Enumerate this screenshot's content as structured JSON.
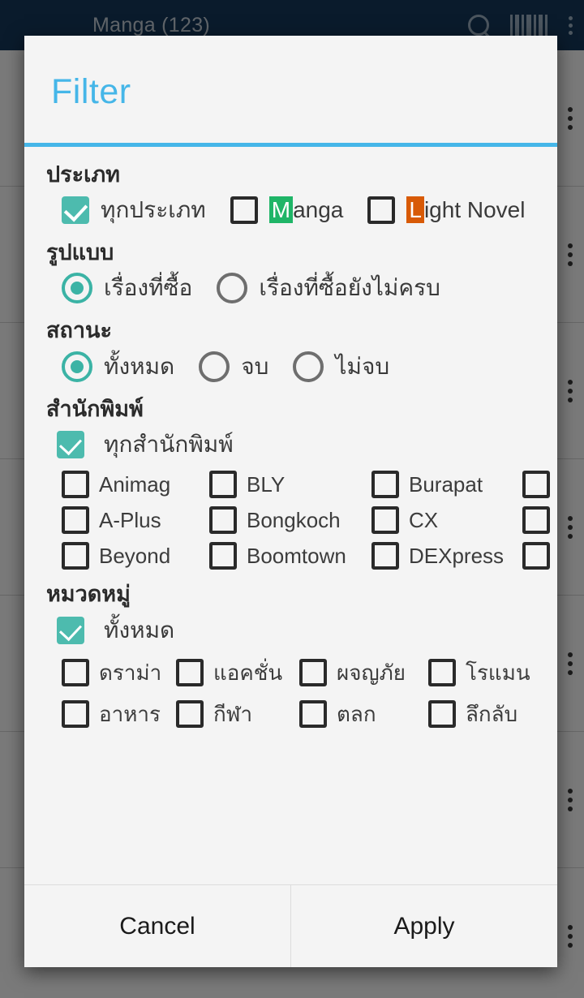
{
  "background": {
    "appbar": {
      "title": "Manga (123)",
      "search_icon": "search-icon",
      "barcode_icon": "barcode-icon",
      "overflow_icon": "overflow-menu-icon"
    }
  },
  "dialog": {
    "title": "Filter",
    "accent_color": "#45b6e8",
    "checked_color": "#4dbbae",
    "radio_color": "#3bb3a5",
    "sections": {
      "type": {
        "title": "ประเภท",
        "options": [
          {
            "label": "ทุกประเภท",
            "checked": true
          },
          {
            "label": "Manga",
            "checked": false,
            "badge": "M",
            "badge_color": "#1fb567",
            "rest": "anga"
          },
          {
            "label": "Light Novel",
            "checked": false,
            "badge": "L",
            "badge_color": "#d85a06",
            "rest": "ight Novel"
          }
        ]
      },
      "format": {
        "title": "รูปแบบ",
        "options": [
          {
            "label": "เรื่องที่ซื้อ",
            "selected": true
          },
          {
            "label": "เรื่องที่ซื้อยังไม่ครบ",
            "selected": false
          }
        ]
      },
      "status": {
        "title": "สถานะ",
        "options": [
          {
            "label": "ทั้งหมด",
            "selected": true
          },
          {
            "label": "จบ",
            "selected": false
          },
          {
            "label": "ไม่จบ",
            "selected": false
          }
        ]
      },
      "publisher": {
        "title": "สำนักพิมพ์",
        "all_label": "ทุกสำนักพิมพ์",
        "all_checked": true,
        "items": [
          {
            "label": "Animag",
            "checked": false
          },
          {
            "label": "BLY",
            "checked": false
          },
          {
            "label": "Burapat",
            "checked": false
          },
          {
            "label": "",
            "checked": false
          },
          {
            "label": "A-Plus",
            "checked": false
          },
          {
            "label": "Bongkoch",
            "checked": false
          },
          {
            "label": "CX",
            "checked": false
          },
          {
            "label": "",
            "checked": false
          },
          {
            "label": "Beyond",
            "checked": false
          },
          {
            "label": "Boomtown",
            "checked": false
          },
          {
            "label": "DEXpress",
            "checked": false
          },
          {
            "label": "",
            "checked": false
          }
        ]
      },
      "category": {
        "title": "หมวดหมู่",
        "all_label": "ทั้งหมด",
        "all_checked": true,
        "items": [
          {
            "label": "ดราม่า",
            "checked": false
          },
          {
            "label": "แอคชั่น",
            "checked": false
          },
          {
            "label": "ผจญภัย",
            "checked": false
          },
          {
            "label": "โรแมน",
            "checked": false
          },
          {
            "label": "อาหาร",
            "checked": false
          },
          {
            "label": "กีฬา",
            "checked": false
          },
          {
            "label": "ตลก",
            "checked": false
          },
          {
            "label": "ลึกลับ",
            "checked": false
          }
        ]
      }
    },
    "footer": {
      "cancel_label": "Cancel",
      "apply_label": "Apply"
    }
  }
}
